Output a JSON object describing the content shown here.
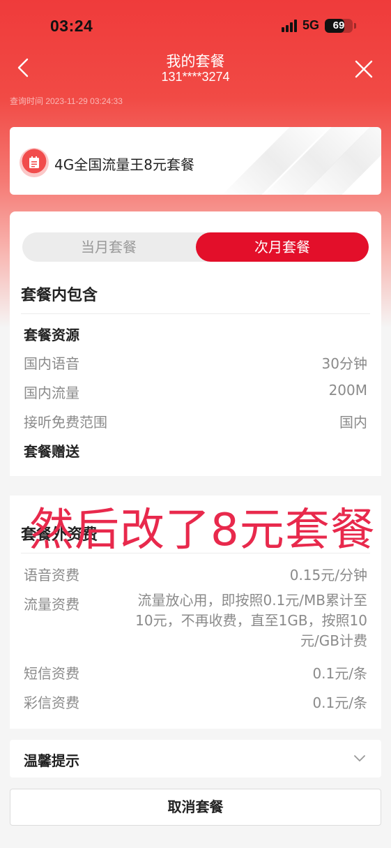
{
  "status_bar": {
    "time": "03:24",
    "network": "5G",
    "battery": "69",
    "battery_level": 0.69
  },
  "nav": {
    "title": "我的套餐",
    "phone": "131****3274"
  },
  "query_time": "查询时间 2023-11-29 03:24:33",
  "plan": {
    "name": "4G全国流量王8元套餐"
  },
  "tabs": {
    "current": "当月套餐",
    "next": "次月套餐",
    "selected": "next"
  },
  "included": {
    "title": "套餐内包含",
    "resources_title": "套餐资源",
    "rows": [
      {
        "label": "国内语音",
        "value": "30分钟"
      },
      {
        "label": "国内流量",
        "value": "200M"
      },
      {
        "label": "接听免费范围",
        "value": "国内"
      }
    ],
    "gift_title": "套餐赠送"
  },
  "overlay_annotation": "然后改了8元套餐",
  "extra_fees": {
    "title": "套餐外资费",
    "rows": [
      {
        "label": "语音资费",
        "value": "0.15元/分钟"
      },
      {
        "label": "流量资费",
        "value": "流量放心用，即按照0.1元/MB累计至10元，不再收费，直至1GB，按照10元/GB计费"
      },
      {
        "label": "短信资费",
        "value": "0.1元/条"
      },
      {
        "label": "彩信资费",
        "value": "0.1元/条"
      }
    ]
  },
  "tips": {
    "title": "温馨提示"
  },
  "cancel_button": "取消套餐",
  "colors": {
    "accent": "#e30f2a",
    "header": "#ef3b3b",
    "overlay": "#e8294c"
  }
}
